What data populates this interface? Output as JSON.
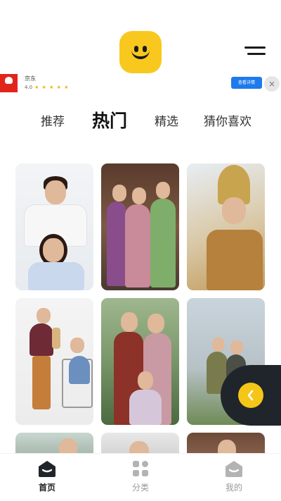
{
  "header": {
    "menu_icon": "hamburger-icon",
    "logo_icon": "smiley-logo"
  },
  "ad": {
    "brand_name": "京东",
    "rating": "4.0",
    "stars": "★ ★ ★ ★ ★",
    "button_label": "查看详情",
    "close_glyph": "×",
    "brand_color": "#e1251b",
    "button_color": "#1f7aed"
  },
  "tabs": [
    {
      "label": "推荐",
      "active": false
    },
    {
      "label": "热门",
      "active": true
    },
    {
      "label": "精选",
      "active": false
    },
    {
      "label": "猜你喜欢",
      "active": false
    }
  ],
  "grid": {
    "card_count": 9
  },
  "float_button": {
    "icon": "chevron-left-icon",
    "color": "#f5c518"
  },
  "bottom_nav": [
    {
      "label": "首页",
      "icon": "home-icon",
      "active": true
    },
    {
      "label": "分类",
      "icon": "category-icon",
      "active": false
    },
    {
      "label": "我的",
      "icon": "profile-icon",
      "active": false
    }
  ],
  "colors": {
    "accent": "#f9c81e",
    "text": "#222222",
    "inactive": "#999999"
  }
}
